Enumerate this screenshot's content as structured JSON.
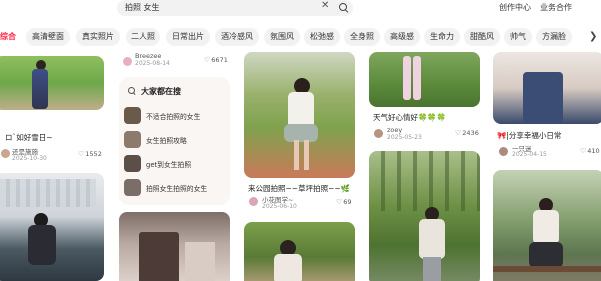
{
  "search": {
    "query": "拍照 女生"
  },
  "header_links": [
    "创作中心",
    "业务合作"
  ],
  "chips": [
    {
      "label": "综合",
      "active": true
    },
    {
      "label": "高清壁面",
      "active": false
    },
    {
      "label": "真实照片",
      "active": false
    },
    {
      "label": "二人照",
      "active": false
    },
    {
      "label": "日常出片",
      "active": false
    },
    {
      "label": "酒冷感风",
      "active": false
    },
    {
      "label": "氛围风",
      "active": false
    },
    {
      "label": "松弛感",
      "active": false
    },
    {
      "label": "全身照",
      "active": false
    },
    {
      "label": "高级感",
      "active": false
    },
    {
      "label": "生命力",
      "active": false
    },
    {
      "label": "甜酷风",
      "active": false
    },
    {
      "label": "帅气",
      "active": false
    },
    {
      "label": "方漏脸",
      "active": false
    }
  ],
  "hot_search": {
    "title": "大家都在搜",
    "items": [
      "不适合拍照的女生",
      "女生拍照攻略",
      "get到女生拍照",
      "拍照女生拍照的女生"
    ]
  },
  "cards": [
    {
      "id": "c1",
      "caption": "ロ`如好雪日~",
      "author": "还是施施",
      "date": "2025-10-30",
      "likes": "1552"
    },
    {
      "id": "c2",
      "caption": "",
      "author": "Breezee",
      "date": "2025-08-14",
      "likes": "6671"
    },
    {
      "id": "c3",
      "caption": "来公园拍照~~草坪拍照~~🌿",
      "author": "小花图学~",
      "date": "2025-06-10",
      "likes": "69"
    },
    {
      "id": "c4",
      "caption": "天气好心情好🍀🍀🍀",
      "author": "zoey",
      "date": "2025-05-23",
      "likes": "2436"
    },
    {
      "id": "c5",
      "caption": "🎀|分享幸福小日常",
      "author": "一只迷",
      "date": "2025-04-15",
      "likes": "410"
    }
  ],
  "colors": {
    "accent": "#ff2442",
    "chip_bg": "#f2f2f2"
  },
  "icons": [
    "search-icon",
    "close-icon",
    "heart-icon",
    "chevron-right-icon"
  ]
}
